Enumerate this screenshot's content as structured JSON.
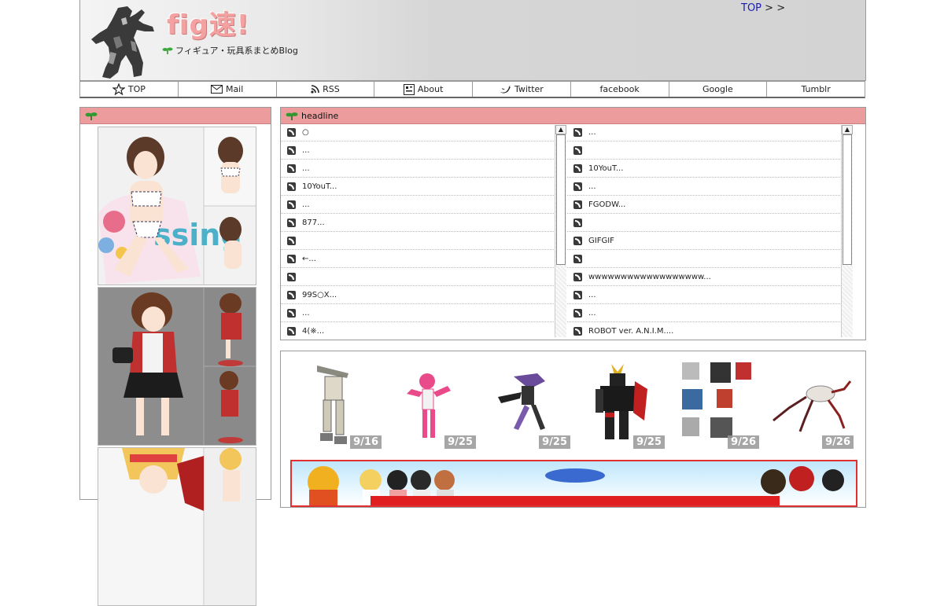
{
  "header": {
    "site_title": "fig速!",
    "tagline": "フィギュア・玩具系まとめBlog",
    "crumb_top": "TOP",
    "crumb_sep1": ">",
    "crumb_sep2": ">"
  },
  "nav": {
    "items": [
      {
        "label": "TOP",
        "icon": "star-icon"
      },
      {
        "label": "Mail",
        "icon": "mail-icon"
      },
      {
        "label": "RSS",
        "icon": "rss-icon"
      },
      {
        "label": "About",
        "icon": "about-icon"
      },
      {
        "label": "Twitter",
        "icon": "twitter-bird-icon"
      },
      {
        "label": "facebook",
        "icon": ""
      },
      {
        "label": "Google",
        "icon": ""
      },
      {
        "label": "Tumblr",
        "icon": ""
      }
    ]
  },
  "headline": {
    "title": "headline",
    "left": [
      "○",
      "...",
      "...",
      "10YouT...",
      "...",
      "877...",
      "",
      "←...",
      "",
      "99S○X...",
      "...",
      "4(※..."
    ],
    "right": [
      "...",
      "",
      "10YouT...",
      "...",
      "FGODW...",
      "",
      "GIFGIF",
      "",
      "wwwwwwwwwwwwwwwwww...",
      "...",
      "...",
      "ROBOT ver. A.N.I.M...."
    ]
  },
  "products": {
    "dates": [
      "9/16",
      "9/25",
      "9/25",
      "9/25",
      "9/26",
      "9/26"
    ]
  },
  "colors": {
    "panel_header": "#ec9c9c",
    "title_pink": "#f3a1a1",
    "link_blue": "#1a1ab0"
  }
}
